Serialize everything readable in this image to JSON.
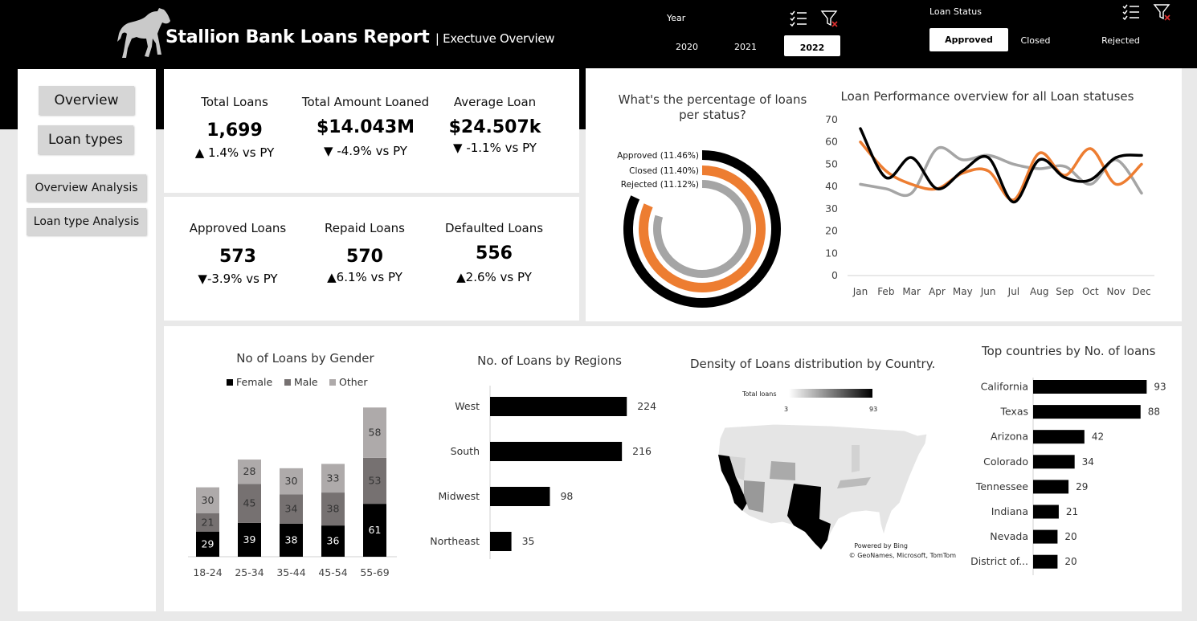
{
  "header": {
    "title": "Stallion Bank Loans Report",
    "subtitle": "| Exectuve Overview",
    "year_label": "Year",
    "years": [
      "2020",
      "2021",
      "2022"
    ],
    "selected_year": "2022",
    "status_label": "Loan Status",
    "statuses": [
      "Approved",
      "Closed",
      "Rejected"
    ],
    "selected_status": "Approved",
    "background_color": "#000000"
  },
  "nav": {
    "overview": "Overview",
    "loan_types": "Loan types",
    "overview_analysis": "Overview Analysis",
    "loan_type_analysis": "Loan type Analysis"
  },
  "kpis": {
    "total_loans": {
      "label": "Total Loans",
      "value": "1,699",
      "delta": "▲ 1.4% vs  PY"
    },
    "total_amount": {
      "label": "Total Amount Loaned",
      "value": "$14.043M",
      "delta": "▼ -4.9% vs PY"
    },
    "average_loan": {
      "label": "Average Loan",
      "value": "$24.507k",
      "delta": "▼ -1.1% vs PY"
    },
    "approved": {
      "label": "Approved Loans",
      "value": "573",
      "delta": "▼-3.9% vs PY"
    },
    "repaid": {
      "label": "Repaid Loans",
      "value": "570",
      "delta": "▲6.1% vs PY"
    },
    "defaulted": {
      "label": "Defaulted Loans",
      "value": "556",
      "delta": "▲2.6% vs PY"
    }
  },
  "colors": {
    "approved": "#000000",
    "closed": "#ed7d31",
    "rejected": "#a5a5a5",
    "female": "#000000",
    "male": "#767171",
    "other": "#aeaaaa"
  },
  "chart_data": [
    {
      "type": "radial-bar",
      "title": "What's the percentage of loans per status?",
      "series": [
        {
          "name": "Approved",
          "label": "Approved (11.46%)",
          "value": 11.46
        },
        {
          "name": "Closed",
          "label": "Closed (11.40%)",
          "value": 11.4
        },
        {
          "name": "Rejected",
          "label": "Rejected (11.12%)",
          "value": 11.12
        }
      ]
    },
    {
      "type": "line",
      "title": "Loan Performance overview for all Loan statuses",
      "categories": [
        "Jan",
        "Feb",
        "Mar",
        "Apr",
        "May",
        "Jun",
        "Jul",
        "Aug",
        "Sep",
        "Oct",
        "Nov",
        "Dec"
      ],
      "ylim": [
        0,
        70
      ],
      "yticks": [
        0,
        10,
        20,
        30,
        40,
        50,
        60,
        70
      ],
      "series": [
        {
          "name": "Approved",
          "values": [
            66,
            44,
            53,
            39,
            47,
            53,
            33,
            52,
            44,
            43,
            53,
            54
          ]
        },
        {
          "name": "Closed",
          "values": [
            60,
            47,
            41,
            39,
            46,
            47,
            34,
            55,
            45,
            57,
            41,
            50
          ]
        },
        {
          "name": "Rejected",
          "values": [
            41,
            39,
            37,
            57,
            52,
            54,
            50,
            48,
            49,
            41,
            52,
            37
          ]
        }
      ]
    },
    {
      "type": "bar",
      "stacked": true,
      "title": "No of Loans by Gender",
      "categories": [
        "18-24",
        "25-34",
        "35-44",
        "45-54",
        "55-69"
      ],
      "legend": [
        "Female",
        "Male",
        "Other"
      ],
      "series": [
        {
          "name": "Female",
          "values": [
            29,
            39,
            38,
            36,
            61
          ]
        },
        {
          "name": "Male",
          "values": [
            21,
            45,
            34,
            38,
            53
          ]
        },
        {
          "name": "Other",
          "values": [
            30,
            28,
            30,
            33,
            58
          ]
        }
      ]
    },
    {
      "type": "bar",
      "orientation": "horizontal",
      "title": "No. of Loans by Regions",
      "categories": [
        "West",
        "South",
        "Midwest",
        "Northeast"
      ],
      "values": [
        224,
        216,
        98,
        35
      ]
    },
    {
      "type": "map",
      "title": "Density of Loans distribution by Country.",
      "legend_title": "Total loans",
      "legend_min": "3",
      "legend_max": "93",
      "credit_1": "Powered by Bing",
      "credit_2": "© GeoNames, Microsoft, TomTom"
    },
    {
      "type": "bar",
      "orientation": "horizontal",
      "title": "Top countries by No. of loans",
      "categories": [
        "California",
        "Texas",
        "Arizona",
        "Colorado",
        "Tennessee",
        "Indiana",
        "Nevada",
        "District of..."
      ],
      "values": [
        93,
        88,
        42,
        34,
        29,
        21,
        20,
        20
      ]
    }
  ]
}
